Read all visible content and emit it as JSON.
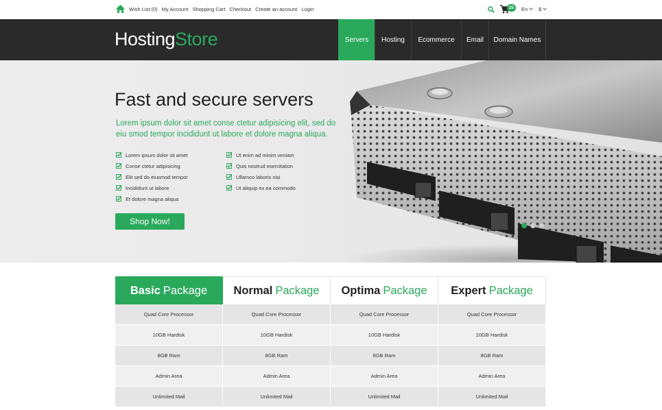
{
  "topbar": {
    "links": [
      "Wish List (0)",
      "My Account",
      "Shopping Cart",
      "Checkout",
      "Create an account",
      "Login"
    ],
    "cart_count": "25",
    "language": "En",
    "currency": "$"
  },
  "header": {
    "logo_part1": "Hosting",
    "logo_part2": "Store",
    "nav": [
      {
        "label": "Servers",
        "active": true
      },
      {
        "label": "Hosting",
        "active": false
      },
      {
        "label": "Ecommerce",
        "active": false
      },
      {
        "label": "Email",
        "active": false
      },
      {
        "label": "Domain Names",
        "active": false
      }
    ]
  },
  "hero": {
    "title": "Fast and secure servers",
    "subtitle": "Lorem ipsum dolor sit amet conse ctetur adipisicing elit, sed do eiu smod tempor incididunt ut labore et dolore magna aliqua.",
    "features_left": [
      "Lorem ipsum dolor sit amet",
      "Conse ctetur adipisicing",
      "Elit sed do eiusmod tempor",
      "Incididunt ut labore",
      "Et dolore magna aliqua"
    ],
    "features_right": [
      "Ut enim ad minim veniam",
      "Quis nostrud exercitation",
      "Ullamco laboris nisi",
      "Ut aliquip ex ea commodo"
    ],
    "button": "Shop Now!",
    "slides": 3,
    "active_slide": 0
  },
  "pricing": {
    "packages": [
      {
        "name": "Basic",
        "suffix": "Package",
        "selected": true
      },
      {
        "name": "Normal",
        "suffix": "Package",
        "selected": false
      },
      {
        "name": "Optima",
        "suffix": "Package",
        "selected": false
      },
      {
        "name": "Expert",
        "suffix": "Package",
        "selected": false
      }
    ],
    "rows": [
      [
        "Quad Core Processor",
        "Quad Core Processor",
        "Quad Core Processor",
        "Quad Core Processor"
      ],
      [
        "10GB Hardisk",
        "10GB Hardisk",
        "10GB Hardisk",
        "10GB Hardisk"
      ],
      [
        "8GB Ram",
        "8GB Ram",
        "8GB Ram",
        "8GB Ram"
      ],
      [
        "Admin Area",
        "Admin Area",
        "Admin Area",
        "Admin Area"
      ],
      [
        "Unlimited Mail",
        "Unlimited Mail",
        "Unlimited Mail",
        "Unlimited Mail"
      ]
    ]
  },
  "colors": {
    "accent": "#2aa95c",
    "header_bg": "#2a2a2a",
    "hero_bg": "#ececec"
  },
  "icons": {
    "home": "home-icon",
    "search": "search-icon",
    "cart": "cart-icon",
    "check": "check-icon"
  }
}
